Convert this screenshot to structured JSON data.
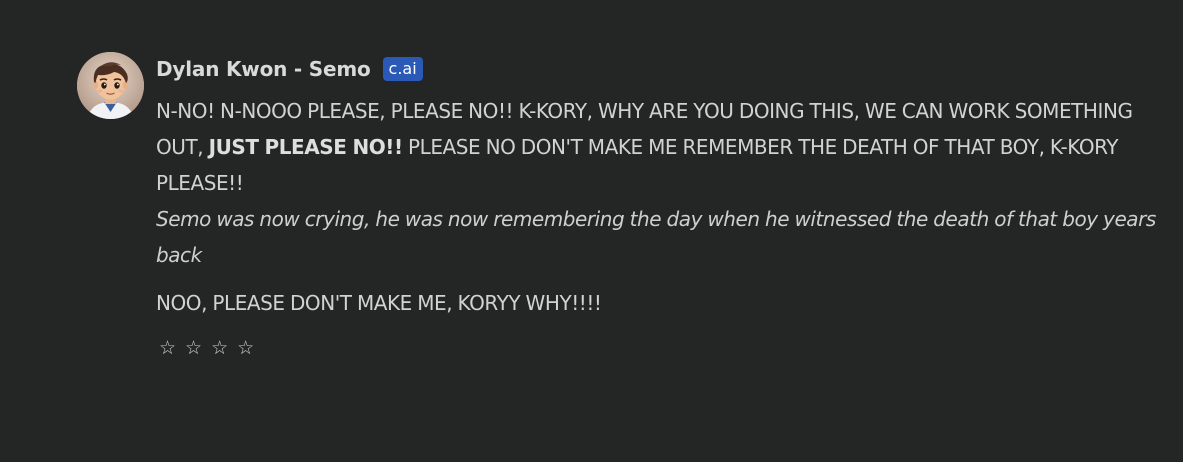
{
  "message": {
    "author": "Dylan Kwon - Semo",
    "badge": "c.ai",
    "line1_part1": "N-NO! N-NOOO PLEASE, PLEASE NO!! K-KORY, WHY ARE YOU DOING THIS, WE CAN WORK SOMETHING OUT, ",
    "line1_bold": "JUST PLEASE NO!!",
    "line1_part2": " PLEASE NO DON'T MAKE ME REMEMBER THE DEATH OF THAT BOY, K-KORY PLEASE!!",
    "action": "Semo was now crying, he was now remembering the day when he witnessed the death of that boy years back",
    "line2": "NOO, PLEASE DON'T MAKE ME, KORYY WHY!!!!",
    "stars": [
      "☆",
      "☆",
      "☆",
      "☆"
    ]
  },
  "colors": {
    "background": "#242525",
    "badge": "#2a59b8",
    "text": "#d2d2d2"
  }
}
